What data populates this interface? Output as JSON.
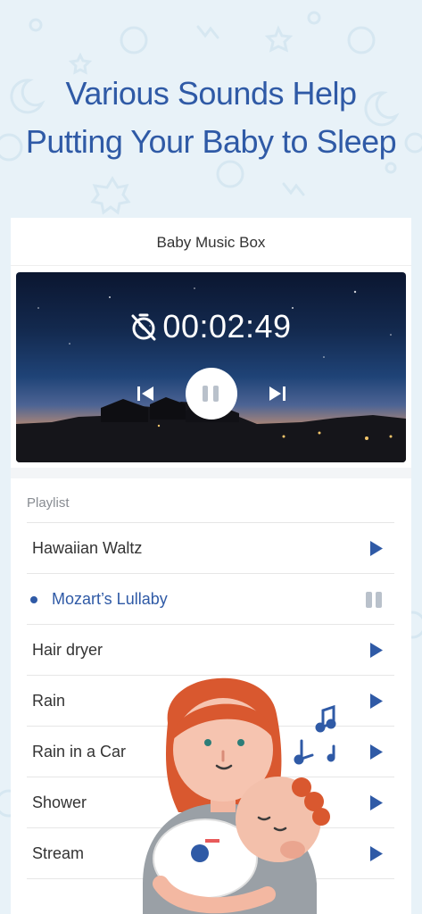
{
  "headline": {
    "line1": "Various Sounds Help",
    "line2": "Putting Your Baby to Sleep"
  },
  "card": {
    "title": "Baby Music Box"
  },
  "player": {
    "timer": "00:02:49",
    "timer_icon": "timer-off-icon",
    "prev_icon": "skip-previous-icon",
    "pause_icon": "pause-icon",
    "next_icon": "skip-next-icon",
    "state": "playing"
  },
  "playlist": {
    "header": "Playlist",
    "items": [
      {
        "label": "Hawaiian Waltz",
        "status": "play"
      },
      {
        "label": "Mozart’s Lullaby",
        "status": "playing"
      },
      {
        "label": "Hair dryer",
        "status": "play"
      },
      {
        "label": "Rain",
        "status": "play"
      },
      {
        "label": "Rain in a Car",
        "status": "play"
      },
      {
        "label": "Shower",
        "status": "play"
      },
      {
        "label": "Stream",
        "status": "play"
      }
    ]
  },
  "colors": {
    "accent": "#2f5aa6",
    "background": "#e8f2f8",
    "inactive_pause": "#b9c1cb",
    "text": "#333333"
  }
}
